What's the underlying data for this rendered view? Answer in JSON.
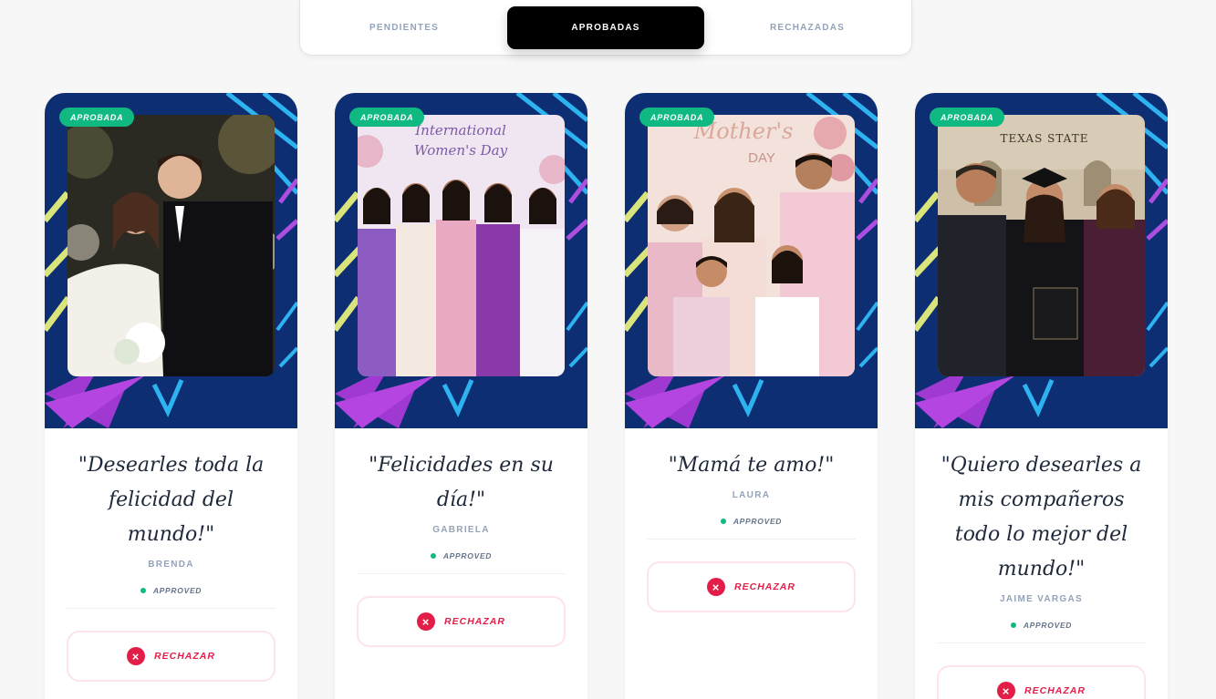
{
  "tabs": [
    {
      "label": "PENDIENTES",
      "active": false
    },
    {
      "label": "APROBADAS",
      "active": true
    },
    {
      "label": "RECHAZADAS",
      "active": false
    }
  ],
  "cards": [
    {
      "badge": "APROBADA",
      "message": "\"Desearles toda la felicidad del mundo!\"",
      "author": "BRENDA",
      "status": "APPROVED",
      "reject_label": "RECHAZAR",
      "photo_text": ""
    },
    {
      "badge": "APROBADA",
      "message": "\"Felicidades en su día!\"",
      "author": "GABRIELA",
      "status": "APPROVED",
      "reject_label": "RECHAZAR",
      "photo_text": "International Women's Day"
    },
    {
      "badge": "APROBADA",
      "message": "\"Mamá te amo!\"",
      "author": "LAURA",
      "status": "APPROVED",
      "reject_label": "RECHAZAR",
      "photo_text": "Mother's DAY"
    },
    {
      "badge": "APROBADA",
      "message": "\"Quiero desearles a mis compañeros todo lo mejor del mundo!\"",
      "author": "JAIME VARGAS",
      "status": "APPROVED",
      "reject_label": "RECHAZAR",
      "photo_text": "TEXAS STATE"
    }
  ],
  "colors": {
    "active_tab": "#000000",
    "approved_badge": "#10b981",
    "reject": "#e11d48",
    "frame": "#0d2e73"
  }
}
